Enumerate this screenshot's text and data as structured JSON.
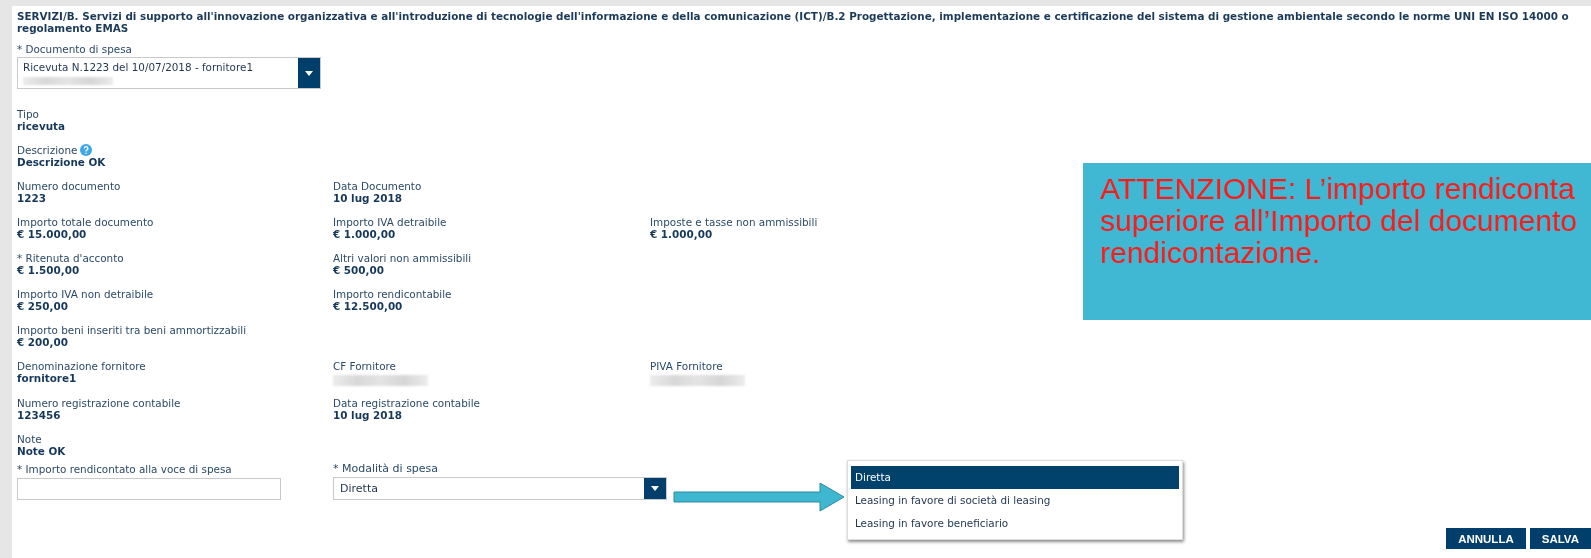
{
  "header": {
    "title": "SERVIZI/B. Servizi di supporto all'innovazione organizzativa e all'introduzione di tecnologie dell'informazione e della comunicazione (ICT)/B.2 Progettazione, implementazione e certificazione del sistema di gestione ambientale secondo le norme UNI EN ISO 14000 o regolamento EMAS"
  },
  "document_select": {
    "label": "* Documento di spesa",
    "value": "Ricevuta N.1223 del 10/07/2018 - fornitore1"
  },
  "field_rows": [
    [
      {
        "label": "Tipo",
        "value": "ricevuta"
      }
    ],
    [
      {
        "label": "Descrizione",
        "value": "Descrizione OK",
        "help": true
      }
    ],
    [
      {
        "label": "Numero documento",
        "value": "1223"
      },
      {
        "label": "Data Documento",
        "value": "10 lug 2018"
      }
    ],
    [
      {
        "label": "Importo totale documento",
        "value": "€ 15.000,00"
      },
      {
        "label": "Importo IVA detraibile",
        "value": "€ 1.000,00"
      },
      {
        "label": "Imposte e tasse non ammissibili",
        "value": "€ 1.000,00"
      }
    ],
    [
      {
        "label": "* Ritenuta d'acconto",
        "value": "€ 1.500,00"
      },
      {
        "label": "Altri valori non ammissibili",
        "value": "€ 500,00"
      }
    ],
    [
      {
        "label": "Importo IVA non detraibile",
        "value": "€ 250,00"
      },
      {
        "label": "Importo rendicontabile",
        "value": "€ 12.500,00"
      }
    ],
    [
      {
        "label": "Importo beni inseriti tra beni ammortizzabili",
        "value": "€ 200,00"
      }
    ],
    [
      {
        "label": "Denominazione fornitore",
        "value": "fornitore1"
      },
      {
        "label": "CF Fornitore",
        "redacted": true
      },
      {
        "label": "PIVA Fornitore",
        "redacted": true
      }
    ],
    [
      {
        "label": "Numero registrazione contabile",
        "value": "123456"
      },
      {
        "label": "Data registrazione contabile",
        "value": "10 lug 2018"
      }
    ],
    [
      {
        "label": "Note",
        "value": "Note OK"
      }
    ]
  ],
  "amount_field": {
    "label": "* Importo rendicontato alla voce di spesa"
  },
  "mode_select": {
    "label": "* Modalità di spesa",
    "value": "Diretta"
  },
  "mode_options": [
    {
      "label": "Diretta",
      "selected": true
    },
    {
      "label": "Leasing in favore di società di leasing",
      "selected": false
    },
    {
      "label": "Leasing in favore beneficiario",
      "selected": false
    }
  ],
  "callout": {
    "lines": [
      "ATTENZIONE: L’importo rendiconta",
      "superiore all’Importo del documento",
      "rendicontazione."
    ]
  },
  "buttons": [
    "ANNULLA",
    "SALVA"
  ]
}
